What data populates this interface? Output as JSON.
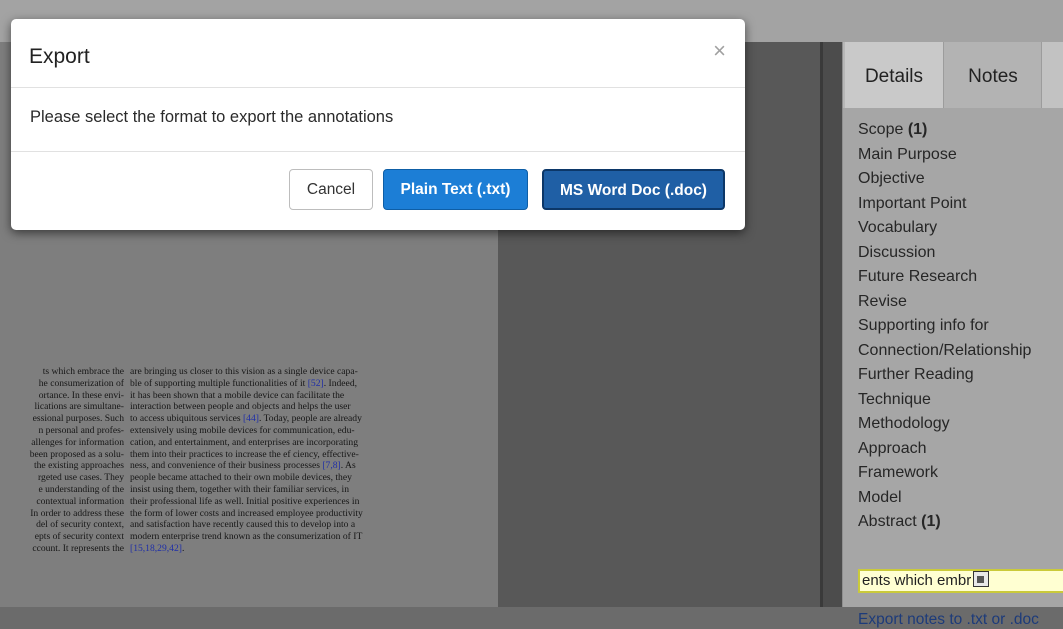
{
  "modal": {
    "title": "Export",
    "close_glyph": "×",
    "message": "Please select the format to export the annotations",
    "buttons": {
      "cancel": "Cancel",
      "plain_text": "Plain Text (.txt)",
      "word_doc": "MS Word Doc (.doc)"
    }
  },
  "panel": {
    "tabs": [
      "Details",
      "Notes"
    ],
    "notes": [
      {
        "label": "Scope",
        "count": "(1)"
      },
      {
        "label": "Main Purpose",
        "count": ""
      },
      {
        "label": "Objective",
        "count": ""
      },
      {
        "label": "Important Point",
        "count": ""
      },
      {
        "label": "Vocabulary",
        "count": ""
      },
      {
        "label": "Discussion",
        "count": ""
      },
      {
        "label": "Future Research",
        "count": ""
      },
      {
        "label": "Revise",
        "count": ""
      },
      {
        "label": "Supporting info for",
        "count": ""
      },
      {
        "label": "Connection/Relationship",
        "count": ""
      },
      {
        "label": "Further Reading",
        "count": ""
      },
      {
        "label": "Technique",
        "count": ""
      },
      {
        "label": "Methodology",
        "count": ""
      },
      {
        "label": "Approach",
        "count": ""
      },
      {
        "label": "Framework",
        "count": ""
      },
      {
        "label": "Model",
        "count": ""
      },
      {
        "label": "Abstract",
        "count": "(1)"
      }
    ],
    "note_input_value": "ents which embr",
    "paste_icon": "clipboard-paste-icon",
    "export_link": "Export notes to .txt or .doc"
  },
  "document": {
    "left_column": [
      "ts which embrace the",
      "he consumerization of",
      "ortance. In these envi-",
      "lications are simultane-",
      "essional purposes. Such",
      "n personal and profes-",
      "allenges for information",
      "been proposed as a solu-",
      "the existing approaches",
      "rgeted use cases. They",
      "e understanding of the",
      "contextual information",
      "In order to address these",
      "del of security context,",
      "epts of security context",
      "ccount. It represents the"
    ],
    "right_column": [
      "are bringing us closer to this vision as a single device capa-",
      "ble of supporting multiple functionalities of it [52]. Indeed,",
      "it has been shown that a mobile device can facilitate the",
      "interaction between people and objects and helps the user",
      "to access ubiquitous services [44]. Today, people are already",
      "extensively using mobile devices for communication, edu-",
      "cation, and entertainment, and enterprises are incorporating",
      "them into their practices to increase the ef ciency, effective-",
      "ness, and convenience of their business processes [7,8]. As",
      "people became attached to their own mobile devices, they",
      "insist using them, together with their familiar services, in",
      "their professional life as well. Initial positive experiences in",
      "the form of lower costs and increased employee productivity",
      "and satisfaction have recently caused this to develop into a",
      "modern enterprise trend known as the consumerization of IT",
      "[15,18,29,42]."
    ]
  }
}
